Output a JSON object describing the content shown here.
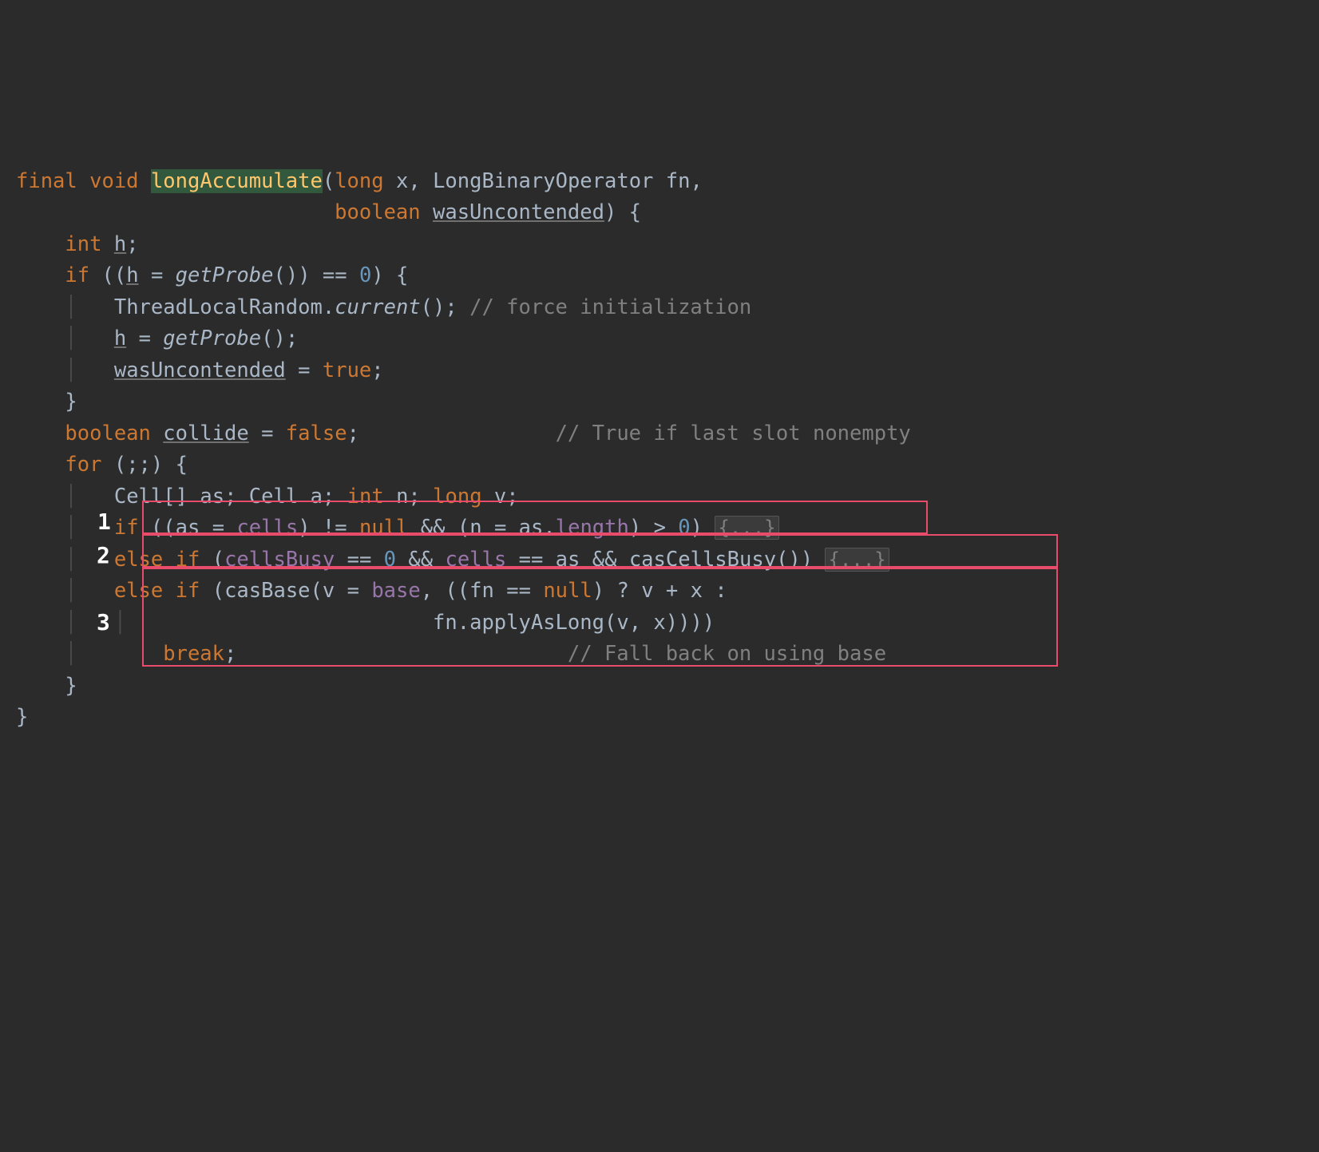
{
  "tokens": {
    "final": "final",
    "void": "void",
    "methodName": "longAccumulate",
    "long": "long",
    "x": "x",
    "LongBinaryOperator": "LongBinaryOperator",
    "fn": "fn",
    "boolean": "boolean",
    "wasUncontended": "wasUncontended",
    "int": "int",
    "h": "h",
    "if": "if",
    "getProbe": "getProbe",
    "eqeq": "==",
    "zero": "0",
    "ThreadLocalRandom": "ThreadLocalRandom",
    "current": "current",
    "comment_force": "// force initialization",
    "true": "true",
    "collide": "collide",
    "false": "false",
    "comment_true_slot": "// True if last slot nonempty",
    "for": "for",
    "Cell": "Cell",
    "as": "as",
    "a": "a",
    "n": "n",
    "v": "v",
    "cells": "cells",
    "ne": "!=",
    "null": "null",
    "andand": "&&",
    "length": "length",
    "gt": ">",
    "fold": "{...}",
    "else": "else",
    "cellsBusy": "cellsBusy",
    "casCellsBusy": "casCellsBusy",
    "casBase": "casBase",
    "base": "base",
    "question": "?",
    "plus": "+",
    "colon": ":",
    "applyAsLong": "applyAsLong",
    "break": "break",
    "comment_fallback": "// Fall back on using base"
  },
  "annotations": {
    "num1": "1",
    "num2": "2",
    "num3": "3"
  }
}
